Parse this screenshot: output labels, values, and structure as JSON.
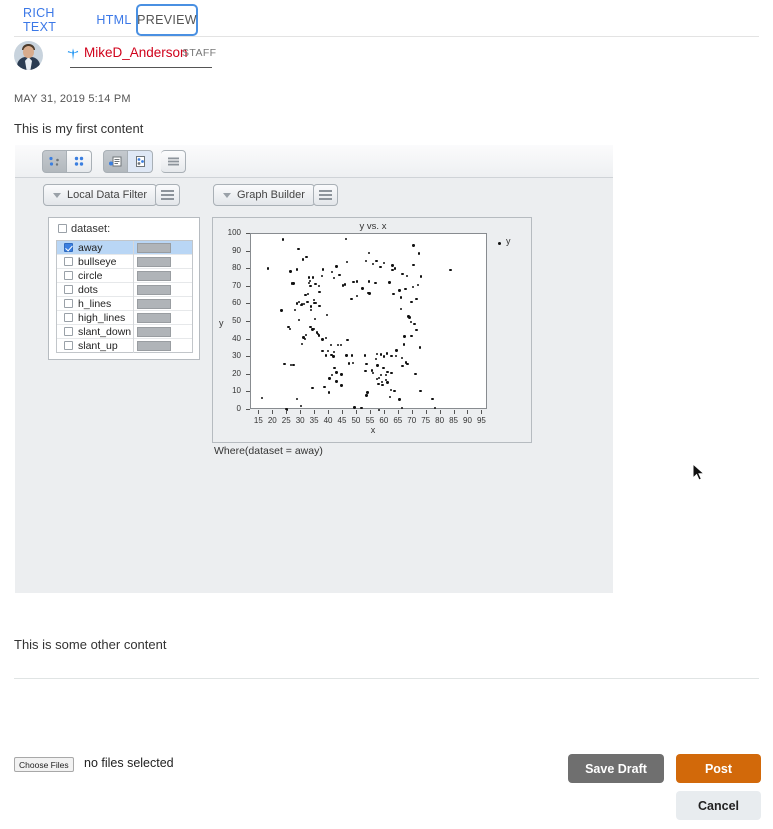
{
  "tabs": [
    {
      "label": "RICH TEXT",
      "active": false
    },
    {
      "label": "HTML",
      "active": false
    },
    {
      "label": "PREVIEW",
      "active": true
    }
  ],
  "author": {
    "username": "MikeD_Anderson",
    "badge": "STAFF",
    "spark_icon": "spark-icon",
    "avatar_icon": "avatar"
  },
  "post": {
    "timestamp": "MAY 31, 2019 5:14 PM",
    "content_1": "This is my first content",
    "content_2": "This is some other content"
  },
  "app": {
    "toolbar_buttons": [
      {
        "name": "scatter-sparse-icon",
        "state": "pressed"
      },
      {
        "name": "scatter-dense-icon",
        "state": "normal"
      },
      {
        "name": "report-panel-icon",
        "state": "pressed"
      },
      {
        "name": "data-table-icon",
        "state": "selected"
      },
      {
        "name": "menu-hamburger-icon",
        "state": "normal"
      }
    ],
    "data_filter": {
      "title": "Local Data Filter",
      "menu_icon": "hamburger-icon",
      "group_label": "dataset:",
      "group_checked": false,
      "items": [
        {
          "label": "away",
          "checked": true,
          "selected": true
        },
        {
          "label": "bullseye",
          "checked": false,
          "selected": false
        },
        {
          "label": "circle",
          "checked": false,
          "selected": false
        },
        {
          "label": "dots",
          "checked": false,
          "selected": false
        },
        {
          "label": "h_lines",
          "checked": false,
          "selected": false
        },
        {
          "label": "high_lines",
          "checked": false,
          "selected": false
        },
        {
          "label": "slant_down",
          "checked": false,
          "selected": false
        },
        {
          "label": "slant_up",
          "checked": false,
          "selected": false
        }
      ]
    },
    "graph_builder": {
      "title": "Graph Builder",
      "menu_icon": "hamburger-icon",
      "caption": "Where(dataset = away)"
    }
  },
  "chart_data": {
    "type": "scatter",
    "title": "y vs. x",
    "xlabel": "x",
    "ylabel": "y",
    "legend": [
      "y"
    ],
    "legend_position": "right",
    "grid": false,
    "xlim": [
      12,
      97
    ],
    "ylim": [
      0,
      100
    ],
    "xticks": [
      15,
      20,
      25,
      30,
      35,
      40,
      45,
      50,
      55,
      60,
      65,
      70,
      75,
      80,
      85,
      90,
      95
    ],
    "yticks": [
      0,
      10,
      20,
      30,
      40,
      50,
      60,
      70,
      80,
      90,
      100
    ],
    "series": [
      {
        "name": "y",
        "color": "#111111",
        "points": [
          [
            32.3,
            61.4
          ],
          [
            53.4,
            26.2
          ],
          [
            63.9,
            30.8
          ],
          [
            70.3,
            82.5
          ],
          [
            34.1,
            45.7
          ],
          [
            67.7,
            27.0
          ],
          [
            53.8,
            10.0
          ],
          [
            46.4,
            84.2
          ],
          [
            42.6,
            81.5
          ],
          [
            28.4,
            79.9
          ],
          [
            60.9,
            15.6
          ],
          [
            58.0,
            -0.1
          ],
          [
            66.3,
            24.9
          ],
          [
            55.8,
            20.9
          ],
          [
            57.3,
            17.5
          ],
          [
            37.7,
            40.0
          ],
          [
            36.6,
            67.1
          ],
          [
            43.7,
            76.8
          ],
          [
            67.4,
            68.9
          ],
          [
            35.0,
            51.6
          ],
          [
            57.0,
            84.6
          ],
          [
            55.8,
            83.1
          ],
          [
            33.6,
            58.7
          ],
          [
            29.3,
            51.3
          ],
          [
            65.3,
            68.0
          ],
          [
            28.4,
            60.4
          ],
          [
            39.3,
            54.0
          ],
          [
            64.2,
            33.8
          ],
          [
            54.4,
            89.3
          ],
          [
            37.8,
            79.8
          ],
          [
            41.1,
            78.4
          ],
          [
            65.9,
            57.5
          ],
          [
            32.7,
            75.2
          ],
          [
            53.2,
            84.5
          ],
          [
            62.8,
            79.4
          ],
          [
            41.8,
            75.1
          ],
          [
            54.3,
            72.9
          ],
          [
            63.7,
            80.5
          ],
          [
            36.4,
            70.4
          ],
          [
            44.9,
            70.8
          ],
          [
            35.1,
            71.6
          ],
          [
            26.1,
            78.8
          ],
          [
            50.0,
            64.9
          ],
          [
            32.9,
            72.2
          ],
          [
            45.8,
            71.4
          ],
          [
            65.7,
            64.0
          ],
          [
            63.1,
            65.9
          ],
          [
            27.2,
            71.8
          ],
          [
            26.7,
            71.8
          ],
          [
            68.5,
            53.2
          ],
          [
            69.3,
            49.9
          ],
          [
            70.6,
            49.0
          ],
          [
            71.3,
            45.4
          ],
          [
            68.9,
            52.5
          ],
          [
            72.6,
            35.6
          ],
          [
            69.6,
            42.1
          ],
          [
            67.0,
            41.7
          ],
          [
            66.8,
            37.3
          ],
          [
            62.4,
            30.8
          ],
          [
            58.6,
            31.6
          ],
          [
            60.8,
            32.2
          ],
          [
            59.8,
            30.3
          ],
          [
            57.2,
            31.8
          ],
          [
            56.9,
            29.1
          ],
          [
            57.4,
            25.2
          ],
          [
            59.5,
            23.9
          ],
          [
            62.4,
            20.9
          ],
          [
            61.0,
            21.6
          ],
          [
            60.4,
            20.0
          ],
          [
            58.7,
            19.8
          ],
          [
            57.9,
            18.1
          ],
          [
            60.5,
            17.2
          ],
          [
            58.9,
            15.8
          ],
          [
            57.7,
            14.6
          ],
          [
            59.1,
            14.3
          ],
          [
            62.3,
            11.2
          ],
          [
            63.5,
            10.7
          ],
          [
            61.8,
            7.5
          ],
          [
            65.3,
            6.0
          ],
          [
            66.1,
            1.2
          ],
          [
            53.4,
            8.2
          ],
          [
            51.6,
            1.3
          ],
          [
            47.1,
            26.5
          ],
          [
            48.3,
            30.9
          ],
          [
            44.2,
            36.9
          ],
          [
            46.6,
            39.9
          ],
          [
            38.9,
            41.0
          ],
          [
            40.8,
            37.1
          ],
          [
            41.8,
            32.8
          ],
          [
            41.6,
            30.5
          ],
          [
            39.7,
            33.5
          ],
          [
            36.3,
            42.3
          ],
          [
            35.6,
            44.1
          ],
          [
            36.0,
            43.2
          ],
          [
            34.5,
            46.0
          ],
          [
            33.3,
            47.3
          ],
          [
            31.8,
            42.5
          ],
          [
            30.9,
            41.1
          ],
          [
            31.3,
            40.4
          ],
          [
            30.2,
            37.6
          ],
          [
            27.8,
            56.7
          ],
          [
            29.9,
            59.8
          ],
          [
            31.0,
            60.3
          ],
          [
            30.4,
            60.0
          ],
          [
            33.5,
            56.9
          ],
          [
            23.5,
            96.9
          ],
          [
            46.0,
            97.3
          ],
          [
            70.3,
            93.5
          ],
          [
            18.0,
            80.3
          ],
          [
            83.5,
            79.6
          ],
          [
            16.0,
            6.8
          ],
          [
            24.5,
            0.5
          ],
          [
            24.9,
            0.2
          ],
          [
            28.6,
            6.1
          ],
          [
            30.0,
            2.3
          ],
          [
            34.0,
            12.5
          ],
          [
            38.4,
            12.9
          ],
          [
            40.0,
            9.9
          ],
          [
            42.6,
            16.1
          ],
          [
            44.5,
            14.0
          ],
          [
            41.0,
            19.8
          ],
          [
            40.2,
            18.0
          ],
          [
            42.0,
            23.9
          ],
          [
            42.6,
            21.3
          ],
          [
            44.5,
            20.1
          ],
          [
            38.9,
            30.9
          ],
          [
            37.7,
            33.4
          ],
          [
            40.9,
            31.2
          ],
          [
            43.1,
            36.9
          ],
          [
            46.2,
            31.0
          ],
          [
            49.1,
            1.5
          ],
          [
            53.0,
            22.0
          ],
          [
            66.2,
            29.6
          ],
          [
            68.2,
            26.0
          ],
          [
            71.0,
            20.4
          ],
          [
            72.8,
            10.8
          ],
          [
            77.1,
            6.1
          ],
          [
            78.0,
            1.3
          ],
          [
            27.3,
            25.4
          ],
          [
            26.4,
            25.7
          ],
          [
            24.0,
            26.3
          ],
          [
            26.0,
            46.0
          ],
          [
            25.5,
            47.2
          ],
          [
            23.0,
            56.6
          ],
          [
            29.2,
            61.4
          ],
          [
            31.5,
            65.4
          ],
          [
            32.5,
            66.0
          ],
          [
            34.6,
            62.5
          ],
          [
            33.3,
            70.3
          ],
          [
            33.1,
            73.4
          ],
          [
            34.2,
            75.3
          ],
          [
            31.9,
            87.1
          ],
          [
            30.6,
            85.6
          ],
          [
            29.0,
            91.5
          ],
          [
            37.5,
            76.2
          ],
          [
            48.6,
            26.8
          ],
          [
            52.9,
            30.9
          ],
          [
            55.4,
            22.4
          ],
          [
            69.6,
            61.3
          ],
          [
            71.3,
            62.9
          ],
          [
            70.2,
            70.0
          ],
          [
            72.9,
            75.9
          ],
          [
            68.0,
            76.0
          ],
          [
            72.0,
            71.1
          ],
          [
            66.4,
            77.3
          ],
          [
            62.8,
            82.0
          ],
          [
            59.8,
            83.6
          ],
          [
            58.5,
            81.3
          ],
          [
            72.2,
            88.9
          ],
          [
            56.6,
            72.2
          ],
          [
            61.7,
            72.5
          ],
          [
            48.7,
            72.6
          ],
          [
            50.0,
            73.1
          ],
          [
            52.0,
            69.1
          ],
          [
            54.1,
            66.4
          ],
          [
            54.5,
            66.1
          ],
          [
            48.0,
            62.9
          ],
          [
            34.8,
            60.7
          ],
          [
            36.6,
            59.0
          ],
          [
            35.4,
            60.8
          ]
        ]
      }
    ]
  },
  "footer": {
    "choose_files_label": "Choose Files",
    "file_status": "no files selected",
    "save_draft_label": "Save Draft",
    "post_label": "Post",
    "cancel_label": "Cancel"
  },
  "colors": {
    "tab_link": "#3b78e7",
    "tab_active_border": "#4a90e2",
    "username": "#d0021b",
    "post_button": "#d2690a",
    "save_button": "#6f6f6f",
    "selected_row": "#b9d6f5"
  }
}
